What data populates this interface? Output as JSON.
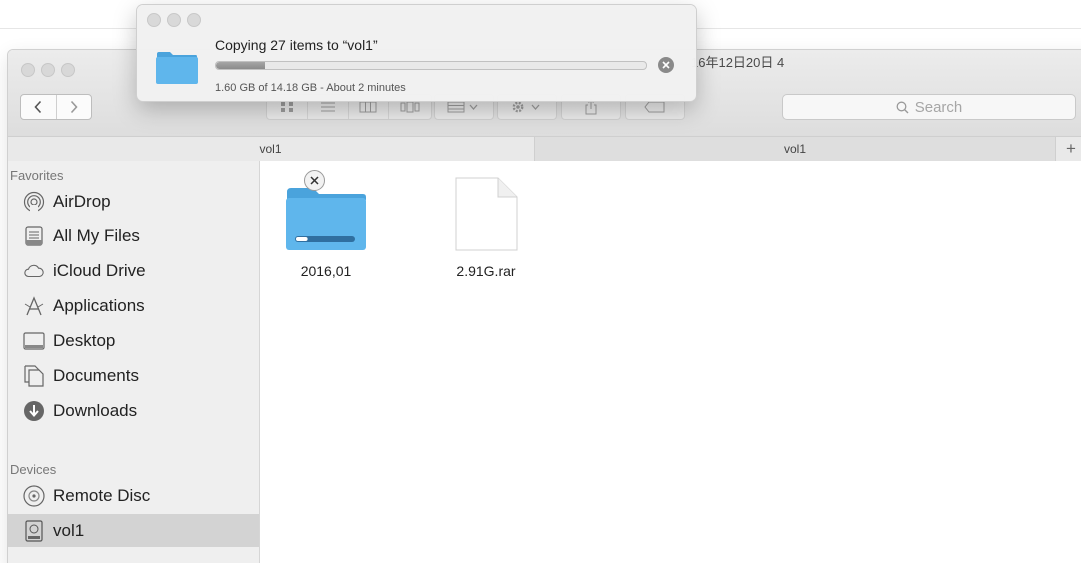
{
  "background_window": {
    "partial_title": "16年12日20日 4"
  },
  "finder": {
    "toolbar": {
      "back": "back",
      "forward": "forward",
      "search_placeholder": "Search"
    },
    "path_tabs": [
      "vol1",
      "vol1"
    ],
    "add_tab": "+",
    "sidebar": {
      "sections": [
        {
          "title": "Favorites",
          "items": [
            {
              "label": "AirDrop",
              "icon": "airdrop-icon"
            },
            {
              "label": "All My Files",
              "icon": "all-my-files-icon"
            },
            {
              "label": "iCloud Drive",
              "icon": "icloud-icon"
            },
            {
              "label": "Applications",
              "icon": "applications-icon"
            },
            {
              "label": "Desktop",
              "icon": "desktop-icon"
            },
            {
              "label": "Documents",
              "icon": "documents-icon"
            },
            {
              "label": "Downloads",
              "icon": "downloads-icon"
            }
          ]
        },
        {
          "title": "Devices",
          "items": [
            {
              "label": "Remote Disc",
              "icon": "remote-disc-icon"
            },
            {
              "label": "vol1",
              "icon": "drive-icon",
              "selected": true
            }
          ]
        }
      ]
    },
    "files": [
      {
        "name": "2016,01",
        "kind": "folder",
        "copying": true,
        "progress": 0.2
      },
      {
        "name": "2.91G.rar",
        "kind": "document"
      }
    ]
  },
  "copy_window": {
    "title": "Copying 27 items to “vol1”",
    "progress": 0.113,
    "status": "1.60 GB of 14.18 GB - About 2 minutes",
    "cancel_icon": "cancel-circle-icon"
  },
  "colors": {
    "folder_blue": "#5fb6ec",
    "sidebar_bg": "#efefef",
    "selected_row": "#d3d3d3"
  }
}
